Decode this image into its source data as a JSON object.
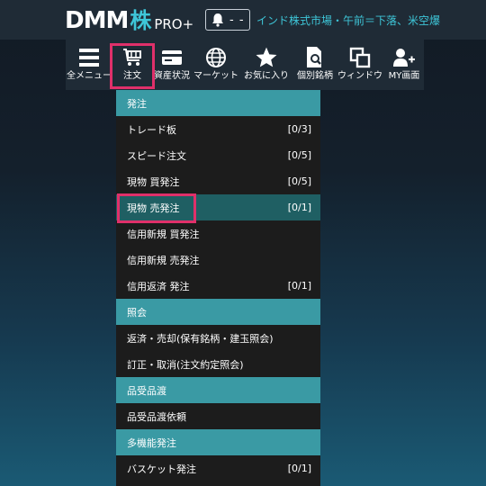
{
  "header": {
    "logo_main": "DMM",
    "logo_accent": "株",
    "logo_suffix": "PRO+",
    "notification_count": "- -",
    "ticker_text": "インド株式市場・午前＝下落、米空爆"
  },
  "nav": {
    "items": [
      {
        "label": "全メニュー",
        "icon": "hamburger-menu-icon"
      },
      {
        "label": "注文",
        "icon": "shopping-cart-icon"
      },
      {
        "label": "資産状況",
        "icon": "wallet-card-icon"
      },
      {
        "label": "マーケット",
        "icon": "globe-icon"
      },
      {
        "label": "お気に入り",
        "icon": "star-icon"
      },
      {
        "label": "個別銘柄",
        "icon": "document-search-icon"
      },
      {
        "label": "ウィンドウ",
        "icon": "windows-icon"
      },
      {
        "label": "MY画面",
        "icon": "user-add-icon"
      }
    ],
    "active": "注文"
  },
  "menu": {
    "rows": [
      {
        "label": "発注",
        "count": "",
        "type": "header"
      },
      {
        "label": "トレード板",
        "count": "[0/3]",
        "type": "item"
      },
      {
        "label": "スピード注文",
        "count": "[0/5]",
        "type": "item"
      },
      {
        "label": "現物 買発注",
        "count": "[0/5]",
        "type": "item"
      },
      {
        "label": "現物 売発注",
        "count": "[0/1]",
        "type": "item"
      },
      {
        "label": "信用新規 買発注",
        "count": "",
        "type": "item"
      },
      {
        "label": "信用新規 売発注",
        "count": "",
        "type": "item"
      },
      {
        "label": "信用返済 発注",
        "count": "[0/1]",
        "type": "item"
      },
      {
        "label": "照会",
        "count": "",
        "type": "header"
      },
      {
        "label": "返済・売却(保有銘柄・建玉照会)",
        "count": "",
        "type": "item"
      },
      {
        "label": "訂正・取消(注文約定照会)",
        "count": "",
        "type": "item"
      },
      {
        "label": "品受品渡",
        "count": "",
        "type": "header"
      },
      {
        "label": "品受品渡依頼",
        "count": "",
        "type": "item"
      },
      {
        "label": "多機能発注",
        "count": "",
        "type": "header"
      },
      {
        "label": "バスケット発注",
        "count": "[0/1]",
        "type": "item"
      }
    ],
    "highlighted": "現物 売発注"
  },
  "colors": {
    "accent": "#3ec6d8",
    "section_header": "#3a9aa4",
    "highlight_row": "#1f5f63",
    "annotation": "#e0306a"
  }
}
